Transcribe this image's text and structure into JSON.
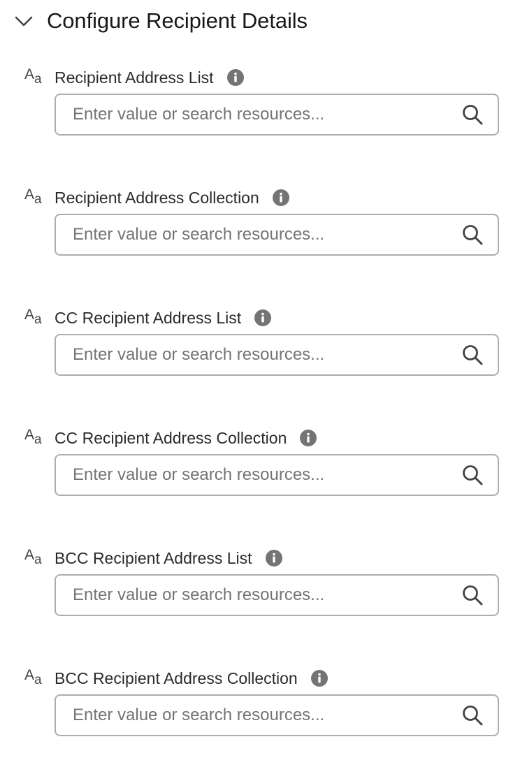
{
  "section": {
    "title": "Configure Recipient Details",
    "collapse_icon": "chevron-down-icon"
  },
  "fields": [
    {
      "label": "Recipient Address List",
      "placeholder": "Enter value or search resources...",
      "value": "",
      "type_icon": "text-type-icon",
      "info_icon": "info-icon",
      "search_icon": "search-icon"
    },
    {
      "label": "Recipient Address Collection",
      "placeholder": "Enter value or search resources...",
      "value": "",
      "type_icon": "text-type-icon",
      "info_icon": "info-icon",
      "search_icon": "search-icon"
    },
    {
      "label": "CC Recipient Address List",
      "placeholder": "Enter value or search resources...",
      "value": "",
      "type_icon": "text-type-icon",
      "info_icon": "info-icon",
      "search_icon": "search-icon"
    },
    {
      "label": "CC Recipient Address Collection",
      "placeholder": "Enter value or search resources...",
      "value": "",
      "type_icon": "text-type-icon",
      "info_icon": "info-icon",
      "search_icon": "search-icon"
    },
    {
      "label": "BCC Recipient Address List",
      "placeholder": "Enter value or search resources...",
      "value": "",
      "type_icon": "text-type-icon",
      "info_icon": "info-icon",
      "search_icon": "search-icon"
    },
    {
      "label": "BCC Recipient Address Collection",
      "placeholder": "Enter value or search resources...",
      "value": "",
      "type_icon": "text-type-icon",
      "info_icon": "info-icon",
      "search_icon": "search-icon"
    }
  ],
  "type_icon_glyphs": {
    "upper": "A",
    "lower": "a"
  },
  "colors": {
    "text": "#181818",
    "label": "#2b2b2b",
    "icon": "#444444",
    "info_icon_bg": "#747474",
    "input_border": "#adadad",
    "placeholder": "#747474"
  }
}
